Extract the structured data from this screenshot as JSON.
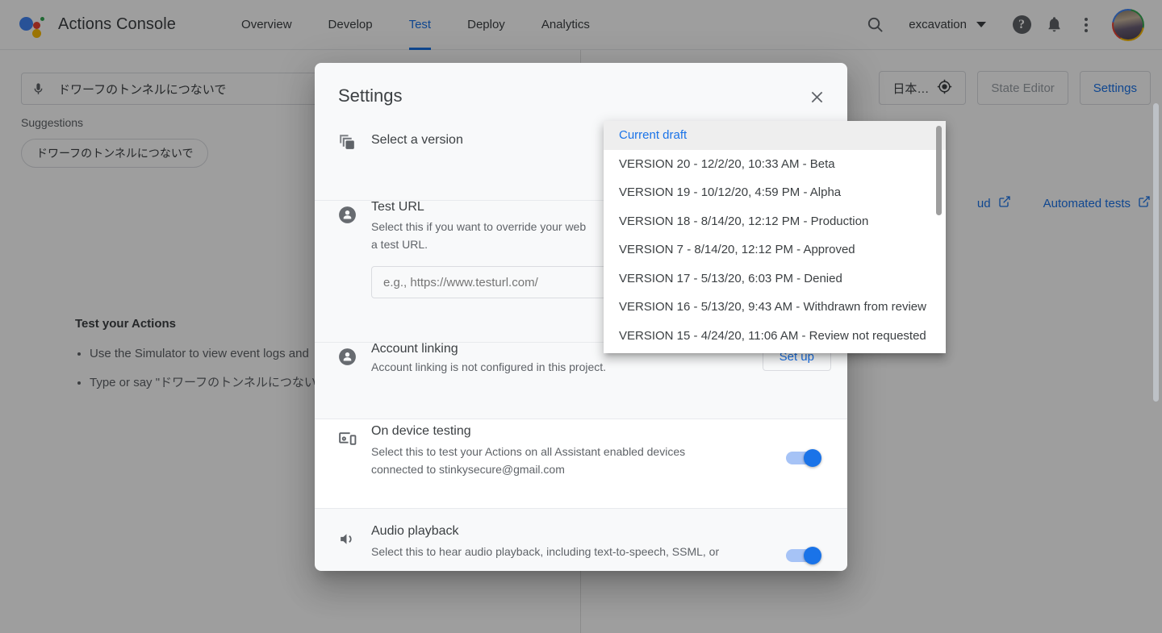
{
  "header": {
    "app_title": "Actions Console",
    "logo_icon": "google-assistant-logo",
    "nav": [
      {
        "label": "Overview",
        "active": false
      },
      {
        "label": "Develop",
        "active": false
      },
      {
        "label": "Test",
        "active": true
      },
      {
        "label": "Deploy",
        "active": false
      },
      {
        "label": "Analytics",
        "active": false
      }
    ],
    "search_icon": "search-icon",
    "project_name": "excavation",
    "help_icon": "help-icon",
    "notifications_icon": "bell-icon",
    "more_icon": "kebab-menu-icon",
    "avatar_icon": "user-avatar"
  },
  "simulator": {
    "input_value": "ドワーフのトンネルにつないで",
    "mic_icon": "microphone-icon",
    "suggestions_label": "Suggestions",
    "suggestion_chips": [
      "ドワーフのトンネルにつないで"
    ],
    "test_your_actions_title": "Test your Actions",
    "bullets": [
      "Use the Simulator to view event logs and",
      "Type or say \"ドワーフのトンネルにつない     device you're logged into with \"stinkysecu"
    ]
  },
  "right_panel": {
    "language_button": "日本…",
    "language_icon": "location-target-icon",
    "state_editor_button": "State Editor",
    "settings_button": "Settings",
    "links": [
      {
        "label": "ud",
        "icon": "external-link-icon"
      },
      {
        "label": "Automated tests",
        "icon": "external-link-icon"
      }
    ]
  },
  "dialog": {
    "title": "Settings",
    "close_icon": "close-icon",
    "select_version": {
      "icon": "layers-copy-icon",
      "label": "Select a version"
    },
    "test_url": {
      "icon": "person-icon",
      "title": "Test URL",
      "description": "Select this if you want to override your web                    a test URL.",
      "description_line1": "Select this if you want to override your web",
      "description_line2": "a test URL.",
      "input_placeholder": "e.g., https://www.testurl.com/",
      "input_value": ""
    },
    "account_linking": {
      "icon": "person-icon",
      "title": "Account linking",
      "description": "Account linking is not configured in this project.",
      "button_label": "Set up"
    },
    "on_device_testing": {
      "icon": "devices-icon",
      "title": "On device testing",
      "description_line1": "Select this to test your Actions on all Assistant enabled devices",
      "description_line2": "connected to stinkysecure@gmail.com",
      "toggle_on": true
    },
    "audio_playback": {
      "icon": "volume-up-icon",
      "title": "Audio playback",
      "description_line1": "Select this to hear audio playback, including text-to-speech, SSML, or",
      "toggle_on": true
    }
  },
  "version_dropdown": {
    "options": [
      {
        "label": "Current draft",
        "selected": true
      },
      {
        "label": "VERSION 20 - 12/2/20, 10:33 AM - Beta",
        "selected": false
      },
      {
        "label": "VERSION 19 - 10/12/20, 4:59 PM - Alpha",
        "selected": false
      },
      {
        "label": "VERSION 18 - 8/14/20, 12:12 PM - Production",
        "selected": false
      },
      {
        "label": "VERSION 7 - 8/14/20, 12:12 PM - Approved",
        "selected": false
      },
      {
        "label": "VERSION 17 - 5/13/20, 6:03 PM - Denied",
        "selected": false
      },
      {
        "label": "VERSION 16 - 5/13/20, 9:43 AM - Withdrawn from review",
        "selected": false
      },
      {
        "label": "VERSION 15 - 4/24/20, 11:06 AM - Review not requested",
        "selected": false
      }
    ]
  },
  "colors": {
    "accent": "#1a73e8",
    "text_primary": "#3c4043",
    "text_secondary": "#5f6368",
    "dialog_bg": "#f8f9fa",
    "selected_option_bg": "#eeeeee"
  }
}
